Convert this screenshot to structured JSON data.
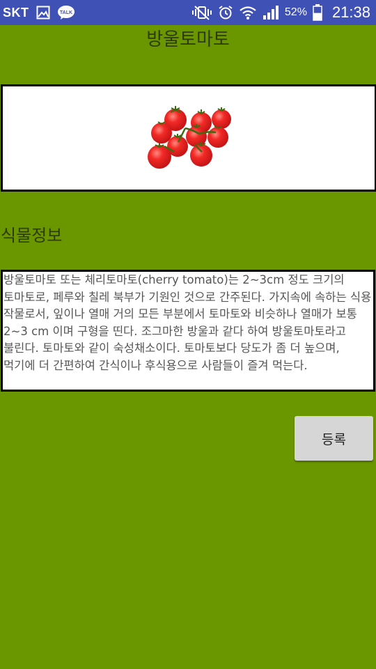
{
  "status_bar": {
    "carrier": "SKT",
    "battery_percent": "52%",
    "time": "21:38",
    "icons": [
      "image-icon",
      "kakaotalk-icon",
      "vibrate-mute-icon",
      "alarm-icon",
      "wifi-icon",
      "signal-icon",
      "battery-icon"
    ],
    "kakao_badge": "TALK",
    "battery_level": 0.52
  },
  "header": {
    "title": "방울토마토"
  },
  "plant_image": {
    "icon": "cherry-tomatoes-image",
    "colors": {
      "tomato": "#e5191c",
      "stem": "#3d6b12"
    }
  },
  "section": {
    "title": "식물정보"
  },
  "description": {
    "text": "방울토마토 또는 체리토마토(cherry tomato)는 2~3cm 정도 크기의 토마토로, 페루와 칠레 북부가 기원인 것으로 간주된다. 가지속에 속하는 식용 작물로서, 잎이나 열매 거의 모든 부분에서 토마토와 비슷하나 열매가 보통 2~3 cm 이며 구형을 띤다. 조그마한 방울과 같다 하여 방울토마토라고 불린다. 토마토와 같이 숙성채소이다. 토마토보다 당도가 좀 더 높으며, 먹기에 더 간편하여 간식이나 후식용으로 사람들이 즐겨 먹는다."
  },
  "actions": {
    "register_label": "등록"
  },
  "colors": {
    "background": "#6a9600",
    "status_bar": "#3f51b5",
    "button": "#d6d6d6"
  }
}
